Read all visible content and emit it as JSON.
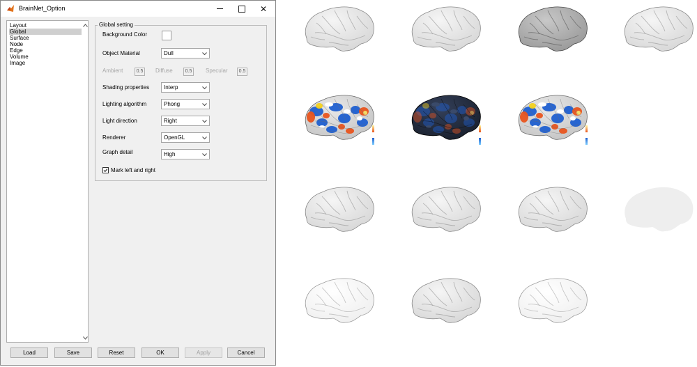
{
  "window": {
    "title": "BrainNet_Option",
    "minimize_label": "",
    "maximize_label": "",
    "close_label": "✕"
  },
  "sidebar": {
    "items": [
      {
        "label": "Layout",
        "selected": false
      },
      {
        "label": "Global",
        "selected": true
      },
      {
        "label": "Surface",
        "selected": false
      },
      {
        "label": "Node",
        "selected": false
      },
      {
        "label": "Edge",
        "selected": false
      },
      {
        "label": "Volume",
        "selected": false
      },
      {
        "label": "Image",
        "selected": false
      }
    ]
  },
  "global": {
    "group_title": "Global setting",
    "background_color_label": "Background Color",
    "background_color": "#ffffff",
    "object_material_label": "Object Material",
    "object_material_value": "Dull",
    "ambient_label": "Ambient",
    "ambient_value": "0.5",
    "diffuse_label": "Diffuse",
    "diffuse_value": "0.5",
    "specular_label": "Specular",
    "specular_value": "0.5",
    "shading_label": "Shading properties",
    "shading_value": "Interp",
    "lighting_label": "Lighting algorithm",
    "lighting_value": "Phong",
    "light_direction_label": "Light direction",
    "light_direction_value": "Right",
    "renderer_label": "Renderer",
    "renderer_value": "OpenGL",
    "graph_detail_label": "Graph detail",
    "graph_detail_value": "High",
    "mark_lr_label": "Mark left and right",
    "mark_lr_checked": true
  },
  "buttons": {
    "load": "Load",
    "save": "Save",
    "reset": "Reset",
    "ok": "OK",
    "apply": "Apply",
    "cancel": "Cancel"
  },
  "colors": {
    "selection": "#cfcfcf",
    "dialog_bg": "#f0f0f0",
    "activation_hot": "#e8541e",
    "activation_cold": "#1f5fd0"
  },
  "brain_grid": {
    "rows": [
      {
        "cells": [
          "brain-light",
          "brain-light",
          "brain-dark-gray",
          "brain-light"
        ]
      },
      {
        "cells": [
          "brain-activation",
          "brain-activation-dark",
          "brain-activation",
          ""
        ]
      },
      {
        "cells": [
          "brain-light",
          "brain-light",
          "brain-light",
          "brain-silhouette"
        ]
      },
      {
        "cells": [
          "brain-white",
          "brain-light",
          "brain-white",
          ""
        ]
      }
    ]
  }
}
